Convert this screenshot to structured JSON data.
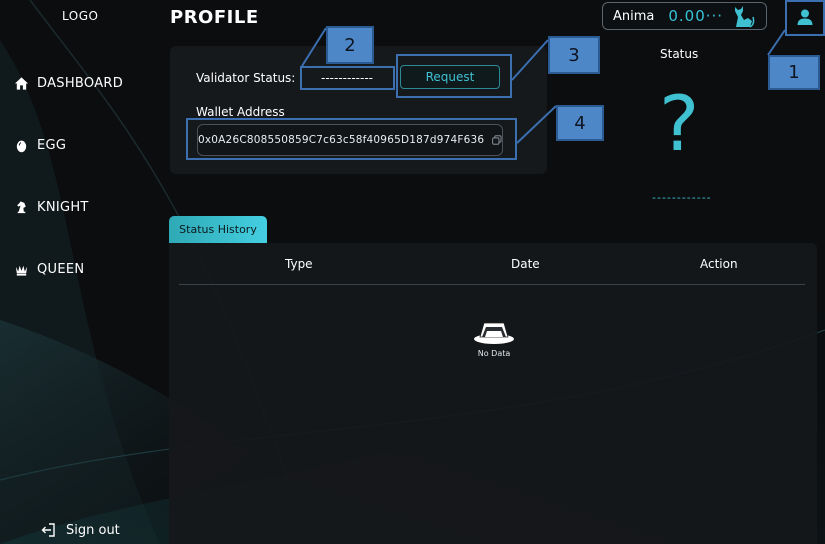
{
  "sidebar": {
    "logo": "LOGO",
    "items": [
      {
        "label": "DASHBOARD",
        "icon": "home-icon"
      },
      {
        "label": "EGG",
        "icon": "egg-icon"
      },
      {
        "label": "KNIGHT",
        "icon": "chess-knight-icon"
      },
      {
        "label": "QUEEN",
        "icon": "chess-queen-icon"
      }
    ],
    "signout": {
      "label": "Sign out",
      "icon": "sign-out-icon"
    }
  },
  "header": {
    "title": "PROFILE",
    "wallet": {
      "label": "Anima",
      "value": "0.00···",
      "icon": "cat-icon"
    },
    "user_icon": "user-icon"
  },
  "profile": {
    "validator_label": "Validator Status:",
    "validator_value": "------------",
    "request_label": "Request",
    "wallet_label": "Wallet Address",
    "wallet_address": "0x0A26C808550859C7c63c58f40965D187d974F636",
    "copy_icon": "copy-icon"
  },
  "status_panel": {
    "title": "Status",
    "symbol": "?",
    "value": "------------"
  },
  "history": {
    "tab_label": "Status History",
    "columns": [
      "Type",
      "Date",
      "Action"
    ],
    "rows": [],
    "empty_text": "No Data"
  },
  "annotations": [
    "1",
    "2",
    "3",
    "4"
  ],
  "colors": {
    "accent": "#3fc1d2",
    "background": "#0b0d0f",
    "card": "#16191c",
    "annotation": "#4e87c8"
  }
}
